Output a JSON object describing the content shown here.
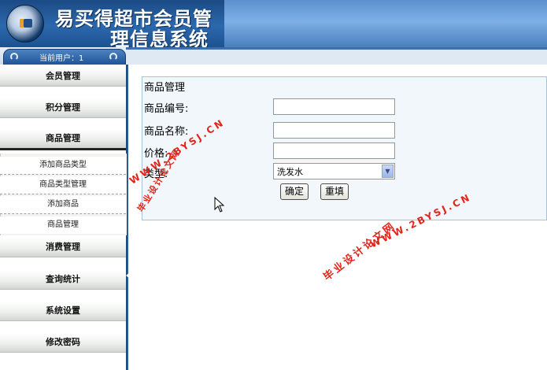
{
  "header": {
    "title_line1": "易买得超市会员管",
    "title_line2": "理信息系统"
  },
  "user_bar": {
    "label": "当前用户：1"
  },
  "sidebar": {
    "menus": [
      {
        "label": "会员管理"
      },
      {
        "label": "积分管理"
      },
      {
        "label": "商品管理"
      },
      {
        "label": "消费管理"
      },
      {
        "label": "查询统计"
      },
      {
        "label": "系统设置"
      },
      {
        "label": "修改密码"
      }
    ],
    "sub_items": [
      {
        "label": "添加商品类型"
      },
      {
        "label": "商品类型管理"
      },
      {
        "label": "添加商品"
      },
      {
        "label": "商品管理"
      }
    ]
  },
  "form": {
    "title": "商品管理",
    "fields": {
      "code_label": "商品编号:",
      "code_value": "",
      "name_label": "商品名称:",
      "name_value": "",
      "price_label": "价格:",
      "price_value": "",
      "type_label": "类型:",
      "type_value": "洗发水"
    },
    "confirm_label": "确定",
    "reset_label": "重填"
  },
  "watermark": {
    "site": "毕业设计论文网",
    "url": "WWW.2BYSJ.CN",
    "color": "#e2231a"
  },
  "colors": {
    "header_dark": "#1b4a84",
    "header_light": "#7eb0e6",
    "panel_bg": "#f2f7fb",
    "panel_border": "#a9c3d6"
  }
}
